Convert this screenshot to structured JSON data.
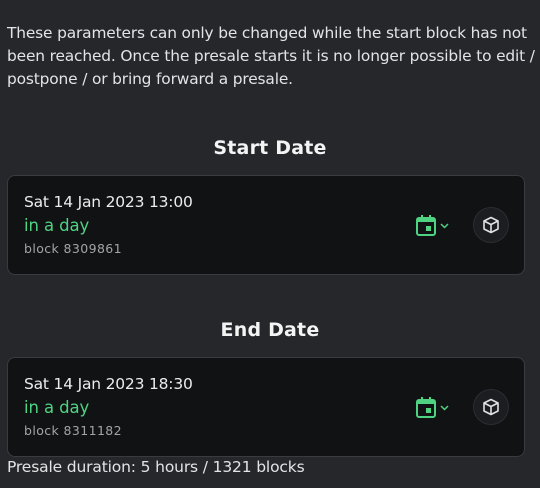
{
  "intro_text": "These parameters can only be changed while the start block has not been reached. Once the presale starts it is no longer possible to edit / postpone / or bring forward a presale.",
  "start": {
    "title": "Start Date",
    "date": "Sat 14 Jan 2023 13:00",
    "relative": "in a day",
    "block": "block 8309861"
  },
  "end": {
    "title": "End Date",
    "date": "Sat 14 Jan 2023 18:30",
    "relative": "in a day",
    "block": "block 8311182"
  },
  "duration": "Presale duration: 5 hours / 1321 blocks",
  "icons": {
    "calendar": "calendar-icon",
    "chevron": "chevron-down-icon",
    "cube": "cube-icon"
  },
  "colors": {
    "background": "#26272b",
    "card": "#111214",
    "accent_green": "#4fd382",
    "muted": "#a3a4a8"
  }
}
